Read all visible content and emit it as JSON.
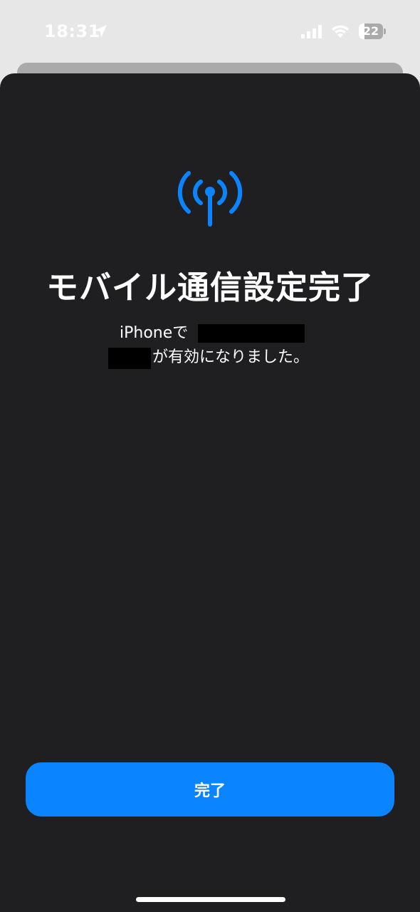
{
  "status_bar": {
    "time": "18:31",
    "battery_level": "22",
    "icons": [
      "location-arrow-icon",
      "cellular-signal-icon",
      "wifi-icon",
      "battery-icon"
    ]
  },
  "main": {
    "icon": "antenna-icon",
    "title": "モバイル通信設定完了",
    "message_line1": "iPhoneで",
    "message_line2": "が有効になりました。"
  },
  "done_button": {
    "label": "完了"
  },
  "colors": {
    "sheet_background": "#1f1f21",
    "accent": "#0a84ff",
    "text": "#ffffff",
    "backdrop": "#e6e7e6"
  }
}
